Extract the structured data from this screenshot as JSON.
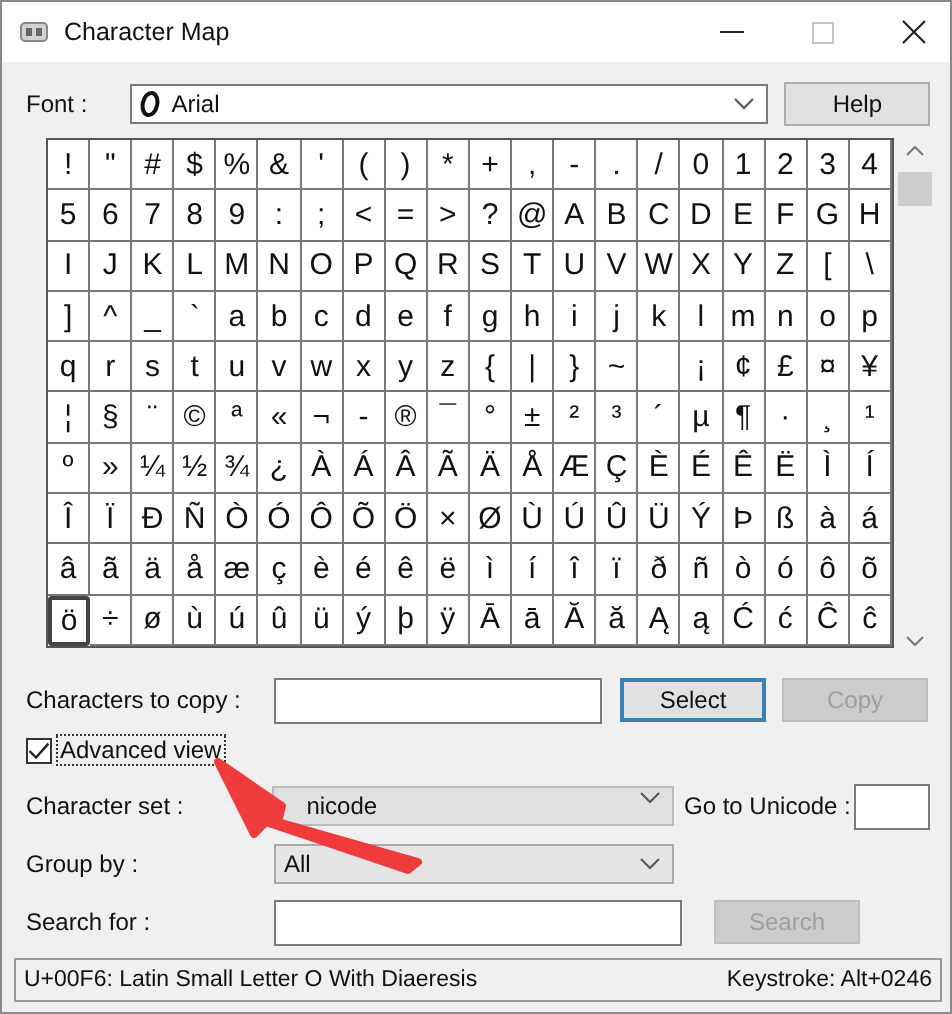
{
  "window": {
    "title": "Character Map"
  },
  "font": {
    "label": "Font :",
    "value": "Arial",
    "help_button": "Help"
  },
  "grid": {
    "rows": [
      [
        {
          "char": "!",
          "selected": false
        },
        {
          "char": "\"",
          "selected": false
        },
        {
          "char": "#",
          "selected": false
        },
        {
          "char": "$",
          "selected": false
        },
        {
          "char": "%",
          "selected": false
        },
        {
          "char": "&",
          "selected": false
        },
        {
          "char": "'",
          "selected": false
        },
        {
          "char": "(",
          "selected": false
        },
        {
          "char": ")",
          "selected": false
        },
        {
          "char": "*",
          "selected": false
        },
        {
          "char": "+",
          "selected": false
        },
        {
          "char": ",",
          "selected": false
        },
        {
          "char": "-",
          "selected": false
        },
        {
          "char": ".",
          "selected": false
        },
        {
          "char": "/",
          "selected": false
        },
        {
          "char": "0",
          "selected": false
        },
        {
          "char": "1",
          "selected": false
        },
        {
          "char": "2",
          "selected": false
        },
        {
          "char": "3",
          "selected": false
        },
        {
          "char": "4",
          "selected": false
        }
      ],
      [
        {
          "char": "5",
          "selected": false
        },
        {
          "char": "6",
          "selected": false
        },
        {
          "char": "7",
          "selected": false
        },
        {
          "char": "8",
          "selected": false
        },
        {
          "char": "9",
          "selected": false
        },
        {
          "char": ":",
          "selected": false
        },
        {
          "char": ";",
          "selected": false
        },
        {
          "char": "<",
          "selected": false
        },
        {
          "char": "=",
          "selected": false
        },
        {
          "char": ">",
          "selected": false
        },
        {
          "char": "?",
          "selected": false
        },
        {
          "char": "@",
          "selected": false
        },
        {
          "char": "A",
          "selected": false
        },
        {
          "char": "B",
          "selected": false
        },
        {
          "char": "C",
          "selected": false
        },
        {
          "char": "D",
          "selected": false
        },
        {
          "char": "E",
          "selected": false
        },
        {
          "char": "F",
          "selected": false
        },
        {
          "char": "G",
          "selected": false
        },
        {
          "char": "H",
          "selected": false
        }
      ],
      [
        {
          "char": "I",
          "selected": false
        },
        {
          "char": "J",
          "selected": false
        },
        {
          "char": "K",
          "selected": false
        },
        {
          "char": "L",
          "selected": false
        },
        {
          "char": "M",
          "selected": false
        },
        {
          "char": "N",
          "selected": false
        },
        {
          "char": "O",
          "selected": false
        },
        {
          "char": "P",
          "selected": false
        },
        {
          "char": "Q",
          "selected": false
        },
        {
          "char": "R",
          "selected": false
        },
        {
          "char": "S",
          "selected": false
        },
        {
          "char": "T",
          "selected": false
        },
        {
          "char": "U",
          "selected": false
        },
        {
          "char": "V",
          "selected": false
        },
        {
          "char": "W",
          "selected": false
        },
        {
          "char": "X",
          "selected": false
        },
        {
          "char": "Y",
          "selected": false
        },
        {
          "char": "Z",
          "selected": false
        },
        {
          "char": "[",
          "selected": false
        },
        {
          "char": "\\",
          "selected": false
        }
      ],
      [
        {
          "char": "]",
          "selected": false
        },
        {
          "char": "^",
          "selected": false
        },
        {
          "char": "_",
          "selected": false
        },
        {
          "char": "`",
          "selected": false
        },
        {
          "char": "a",
          "selected": false
        },
        {
          "char": "b",
          "selected": false
        },
        {
          "char": "c",
          "selected": false
        },
        {
          "char": "d",
          "selected": false
        },
        {
          "char": "e",
          "selected": false
        },
        {
          "char": "f",
          "selected": false
        },
        {
          "char": "g",
          "selected": false
        },
        {
          "char": "h",
          "selected": false
        },
        {
          "char": "i",
          "selected": false
        },
        {
          "char": "j",
          "selected": false
        },
        {
          "char": "k",
          "selected": false
        },
        {
          "char": "l",
          "selected": false
        },
        {
          "char": "m",
          "selected": false
        },
        {
          "char": "n",
          "selected": false
        },
        {
          "char": "o",
          "selected": false
        },
        {
          "char": "p",
          "selected": false
        }
      ],
      [
        {
          "char": "q",
          "selected": false
        },
        {
          "char": "r",
          "selected": false
        },
        {
          "char": "s",
          "selected": false
        },
        {
          "char": "t",
          "selected": false
        },
        {
          "char": "u",
          "selected": false
        },
        {
          "char": "v",
          "selected": false
        },
        {
          "char": "w",
          "selected": false
        },
        {
          "char": "x",
          "selected": false
        },
        {
          "char": "y",
          "selected": false
        },
        {
          "char": "z",
          "selected": false
        },
        {
          "char": "{",
          "selected": false
        },
        {
          "char": "|",
          "selected": false
        },
        {
          "char": "}",
          "selected": false
        },
        {
          "char": "~",
          "selected": false
        },
        {
          "selected": false
        },
        {
          "char": "¡",
          "selected": false
        },
        {
          "char": "¢",
          "selected": false
        },
        {
          "char": "£",
          "selected": false
        },
        {
          "char": "¤",
          "selected": false
        },
        {
          "char": "¥",
          "selected": false
        }
      ],
      [
        {
          "char": "¦",
          "selected": false
        },
        {
          "char": "§",
          "selected": false
        },
        {
          "char": "¨",
          "selected": false
        },
        {
          "char": "©",
          "selected": false
        },
        {
          "char": "ª",
          "selected": false
        },
        {
          "char": "«",
          "selected": false
        },
        {
          "char": "¬",
          "selected": false
        },
        {
          "char": "-",
          "selected": false
        },
        {
          "char": "®",
          "selected": false
        },
        {
          "char": "¯",
          "selected": false
        },
        {
          "char": "°",
          "selected": false
        },
        {
          "char": "±",
          "selected": false
        },
        {
          "char": "²",
          "selected": false
        },
        {
          "char": "³",
          "selected": false
        },
        {
          "char": "´",
          "selected": false
        },
        {
          "char": "µ",
          "selected": false
        },
        {
          "char": "¶",
          "selected": false
        },
        {
          "char": "·",
          "selected": false
        },
        {
          "char": "¸",
          "selected": false
        },
        {
          "char": "¹",
          "selected": false
        }
      ],
      [
        {
          "char": "º",
          "selected": false
        },
        {
          "char": "»",
          "selected": false
        },
        {
          "char": "¼",
          "selected": false
        },
        {
          "char": "½",
          "selected": false
        },
        {
          "char": "¾",
          "selected": false
        },
        {
          "char": "¿",
          "selected": false
        },
        {
          "char": "À",
          "selected": false
        },
        {
          "char": "Á",
          "selected": false
        },
        {
          "char": "Â",
          "selected": false
        },
        {
          "char": "Ã",
          "selected": false
        },
        {
          "char": "Ä",
          "selected": false
        },
        {
          "char": "Å",
          "selected": false
        },
        {
          "char": "Æ",
          "selected": false
        },
        {
          "char": "Ç",
          "selected": false
        },
        {
          "char": "È",
          "selected": false
        },
        {
          "char": "É",
          "selected": false
        },
        {
          "char": "Ê",
          "selected": false
        },
        {
          "char": "Ë",
          "selected": false
        },
        {
          "char": "Ì",
          "selected": false
        },
        {
          "char": "Í",
          "selected": false
        }
      ],
      [
        {
          "char": "Î",
          "selected": false
        },
        {
          "char": "Ï",
          "selected": false
        },
        {
          "char": "Ð",
          "selected": false
        },
        {
          "char": "Ñ",
          "selected": false
        },
        {
          "char": "Ò",
          "selected": false
        },
        {
          "char": "Ó",
          "selected": false
        },
        {
          "char": "Ô",
          "selected": false
        },
        {
          "char": "Õ",
          "selected": false
        },
        {
          "char": "Ö",
          "selected": false
        },
        {
          "char": "×",
          "selected": false
        },
        {
          "char": "Ø",
          "selected": false
        },
        {
          "char": "Ù",
          "selected": false
        },
        {
          "char": "Ú",
          "selected": false
        },
        {
          "char": "Û",
          "selected": false
        },
        {
          "char": "Ü",
          "selected": false
        },
        {
          "char": "Ý",
          "selected": false
        },
        {
          "char": "Þ",
          "selected": false
        },
        {
          "char": "ß",
          "selected": false
        },
        {
          "char": "à",
          "selected": false
        },
        {
          "char": "á",
          "selected": false
        }
      ],
      [
        {
          "char": "â",
          "selected": false
        },
        {
          "char": "ã",
          "selected": false
        },
        {
          "char": "ä",
          "selected": false
        },
        {
          "char": "å",
          "selected": false
        },
        {
          "char": "æ",
          "selected": false
        },
        {
          "char": "ç",
          "selected": false
        },
        {
          "char": "è",
          "selected": false
        },
        {
          "char": "é",
          "selected": false
        },
        {
          "char": "ê",
          "selected": false
        },
        {
          "char": "ë",
          "selected": false
        },
        {
          "char": "ì",
          "selected": false
        },
        {
          "char": "í",
          "selected": false
        },
        {
          "char": "î",
          "selected": false
        },
        {
          "char": "ï",
          "selected": false
        },
        {
          "char": "ð",
          "selected": false
        },
        {
          "char": "ñ",
          "selected": false
        },
        {
          "char": "ò",
          "selected": false
        },
        {
          "char": "ó",
          "selected": false
        },
        {
          "char": "ô",
          "selected": false
        },
        {
          "char": "õ",
          "selected": false
        }
      ],
      [
        {
          "char": "ö",
          "selected": true
        },
        {
          "char": "÷",
          "selected": false
        },
        {
          "char": "ø",
          "selected": false
        },
        {
          "char": "ù",
          "selected": false
        },
        {
          "char": "ú",
          "selected": false
        },
        {
          "char": "û",
          "selected": false
        },
        {
          "char": "ü",
          "selected": false
        },
        {
          "char": "ý",
          "selected": false
        },
        {
          "char": "þ",
          "selected": false
        },
        {
          "char": "ÿ",
          "selected": false
        },
        {
          "char": "Ā",
          "selected": false
        },
        {
          "char": "ā",
          "selected": false
        },
        {
          "char": "Ă",
          "selected": false
        },
        {
          "char": "ă",
          "selected": false
        },
        {
          "char": "Ą",
          "selected": false
        },
        {
          "char": "ą",
          "selected": false
        },
        {
          "char": "Ć",
          "selected": false
        },
        {
          "char": "ć",
          "selected": false
        },
        {
          "char": "Ĉ",
          "selected": false
        },
        {
          "char": "ĉ",
          "selected": false
        }
      ]
    ]
  },
  "copy": {
    "label": "Characters to copy :",
    "select_button": "Select",
    "copy_button": "Copy",
    "copy_disabled": true
  },
  "advanced_view": {
    "label": "Advanced view",
    "checked": true
  },
  "character_set": {
    "label": "Character set :",
    "value": "nicode",
    "disabled": true
  },
  "goto_unicode": {
    "label": "Go to Unicode :"
  },
  "group_by": {
    "label": "Group by :",
    "value": "All"
  },
  "search": {
    "label": "Search for :",
    "button": "Search",
    "button_disabled": true
  },
  "status_bar": {
    "description": "U+00F6: Latin Small Letter O With Diaeresis",
    "keystroke": "Keystroke: Alt+0246"
  },
  "annotation": {
    "kind": "arrow"
  }
}
